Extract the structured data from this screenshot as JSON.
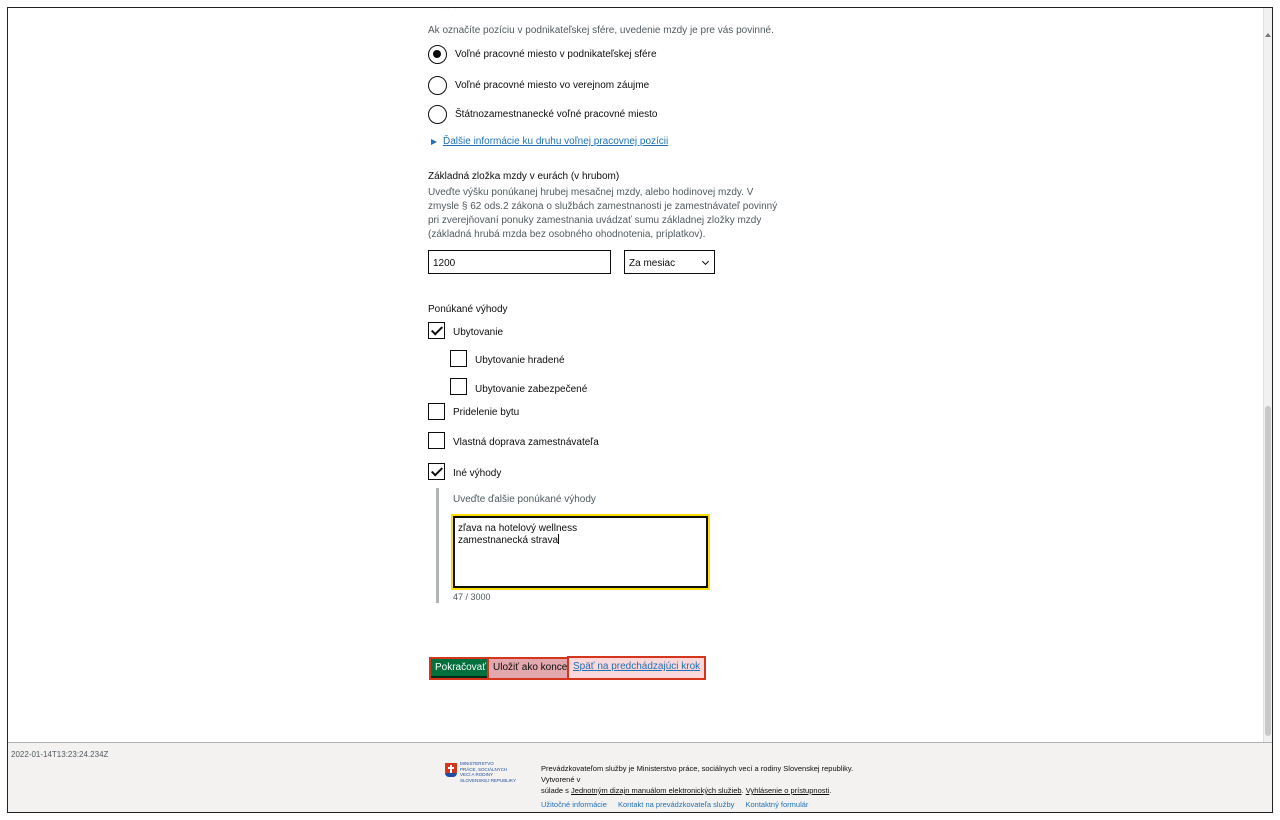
{
  "form": {
    "position_intro_hint": "Ak označíte pozíciu v podnikateľskej sfére, uvedenie mzdy je pre vás povinné.",
    "position_options": [
      {
        "label": "Voľné pracovné miesto v podnikateľskej sfére",
        "checked": true
      },
      {
        "label": "Voľné pracovné miesto vo verejnom záujme",
        "checked": false
      },
      {
        "label": "Štátnozamestnanecké voľné pracovné miesto",
        "checked": false
      }
    ],
    "details_link": "Ďalšie informácie ku druhu voľnej pracovnej pozícii",
    "salary": {
      "label": "Základná zložka mzdy v eurách (v hrubom)",
      "hint_lines": [
        "Uveďte výšku ponúkanej hrubej mesačnej mzdy, alebo hodinovej mzdy. V",
        "zmysle § 62 ods.2 zákona o službách zamestnanosti je zamestnávateľ povinný",
        "pri zverejňovaní ponuky zamestnania uvádzať sumu základnej zložky mzdy",
        "(základná hrubá mzda bez osobného ohodnotenia, príplatkov)."
      ],
      "value": "1200",
      "period_selected": "Za mesiac"
    },
    "benefits": {
      "label": "Ponúkané výhody",
      "items": [
        {
          "label": "Ubytovanie",
          "checked": true
        },
        {
          "label": "Ubytovanie hradené",
          "checked": false
        },
        {
          "label": "Ubytovanie zabezpečené",
          "checked": false
        },
        {
          "label": "Pridelenie bytu",
          "checked": false
        },
        {
          "label": "Vlastná doprava zamestnávateľa",
          "checked": false
        },
        {
          "label": "Iné výhody",
          "checked": true
        }
      ],
      "other_label": "Uveďte ďalšie ponúkané výhody",
      "other_value_lines": [
        "zľava na hotelový wellness",
        "zamestnanecká strava"
      ],
      "char_count": "47 / 3000"
    }
  },
  "actions": {
    "continue": "Pokračovať",
    "save_draft": "Uložiť ako koncept",
    "back": "Späť na predchádzajúci krok"
  },
  "footer": {
    "timestamp": "2022-01-14T13:23:24.234Z",
    "logo_lines": [
      "Ministerstvo",
      "práce, sociálnych",
      "vecí a rodiny",
      "Slovenskej republiky"
    ],
    "operator_text_1": "Prevádzkovateľom služby je Ministerstvo práce, sociálnych vecí a rodiny Slovenskej republiky. Vytvorené v",
    "operator_text_2_prefix": "súlade s ",
    "operator_link_1": "Jednotným dizajn manuálom elektronických služieb",
    "operator_text_2_mid": ". ",
    "operator_link_2": "Vyhlásenie o prístupnosti",
    "operator_text_2_suffix": ".",
    "links": [
      "Užitočné informácie",
      "Kontakt na prevádzkovateľa služby",
      "Kontaktný formulár"
    ]
  }
}
